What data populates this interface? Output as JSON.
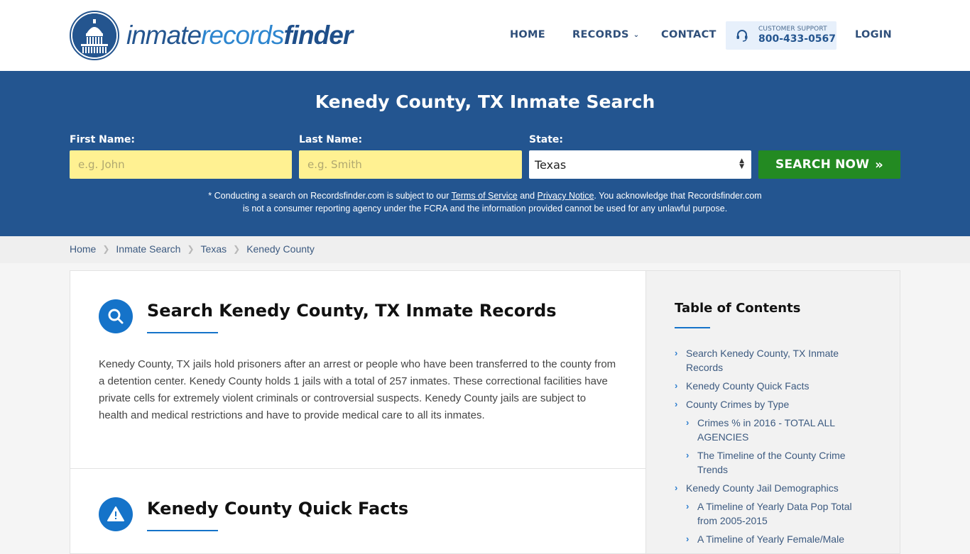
{
  "header": {
    "logo": {
      "part1": "inmate",
      "part2": "records",
      "part3": "finder"
    },
    "nav": {
      "home": "HOME",
      "records": "RECORDS",
      "contact": "CONTACT",
      "login": "LOGIN"
    },
    "support": {
      "label": "CUSTOMER SUPPORT",
      "phone": "800-433-0567",
      "icon": "headset-icon"
    }
  },
  "hero": {
    "title": "Kenedy County, TX Inmate Search",
    "first_name": {
      "label": "First Name:",
      "placeholder": "e.g. John",
      "value": ""
    },
    "last_name": {
      "label": "Last Name:",
      "placeholder": "e.g. Smith",
      "value": ""
    },
    "state": {
      "label": "State:",
      "selected": "Texas"
    },
    "search_button": "SEARCH NOW",
    "disclaimer": {
      "prefix": "* Conducting a search on Recordsfinder.com is subject to our ",
      "terms_link": "Terms of Service",
      "and": " and ",
      "privacy_link": "Privacy Notice",
      "suffix_line1": ". You acknowledge that Recordsfinder.com",
      "line2": "is not a consumer reporting agency under the FCRA and the information provided cannot be used for any unlawful purpose."
    }
  },
  "breadcrumb": [
    "Home",
    "Inmate Search",
    "Texas",
    "Kenedy County"
  ],
  "main": {
    "sections": [
      {
        "icon": "search-icon",
        "title": "Search Kenedy County, TX Inmate Records",
        "body": "Kenedy County, TX jails hold prisoners after an arrest or people who have been transferred to the county from a detention center. Kenedy County holds 1 jails with a total of 257 inmates. These correctional facilities have private cells for extremely violent criminals or controversial suspects. Kenedy County jails are subject to health and medical restrictions and have to provide medical care to all its inmates."
      },
      {
        "icon": "warning-icon",
        "title": "Kenedy County Quick Facts"
      }
    ]
  },
  "toc": {
    "title": "Table of Contents",
    "items": [
      {
        "label": "Search Kenedy County, TX Inmate Records",
        "level": 1
      },
      {
        "label": "Kenedy County Quick Facts",
        "level": 1
      },
      {
        "label": "County Crimes by Type",
        "level": 1
      },
      {
        "label": "Crimes % in 2016 - TOTAL ALL AGENCIES",
        "level": 2
      },
      {
        "label": "The Timeline of the County Crime Trends",
        "level": 2
      },
      {
        "label": "Kenedy County Jail Demographics",
        "level": 1
      },
      {
        "label": "A Timeline of Yearly Data Pop Total from 2005-2015",
        "level": 2
      },
      {
        "label": "A Timeline of Yearly Female/Male",
        "level": 2
      }
    ]
  },
  "colors": {
    "brand_blue": "#235590",
    "accent_blue": "#1573c9",
    "input_yellow": "#fff192",
    "search_green": "#238a22",
    "support_bg": "#e7f0fb"
  }
}
